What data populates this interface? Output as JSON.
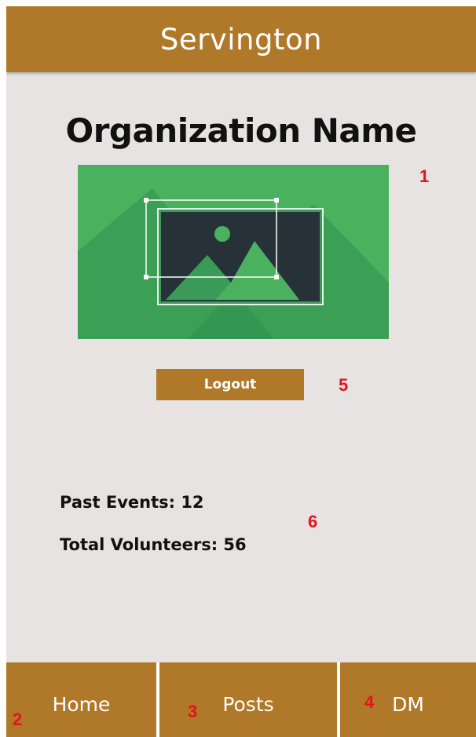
{
  "header": {
    "title": "Servington"
  },
  "organization": {
    "name": "Organization Name",
    "image": "image-placeholder-icon"
  },
  "actions": {
    "logout_label": "Logout"
  },
  "stats": {
    "past_events": "Past Events: 12",
    "total_volunteers": "Total Volunteers: 56"
  },
  "markers": {
    "image": "1",
    "home": "2",
    "posts": "3",
    "dm": "4",
    "logout": "5",
    "stats": "6"
  },
  "nav": {
    "home_label": "Home",
    "posts_label": "Posts",
    "dm_label": "DM"
  },
  "colors": {
    "brand": "#b07829",
    "background": "#e6e3e2",
    "marker": "#e5131b",
    "image_green": "#4ab25f"
  }
}
